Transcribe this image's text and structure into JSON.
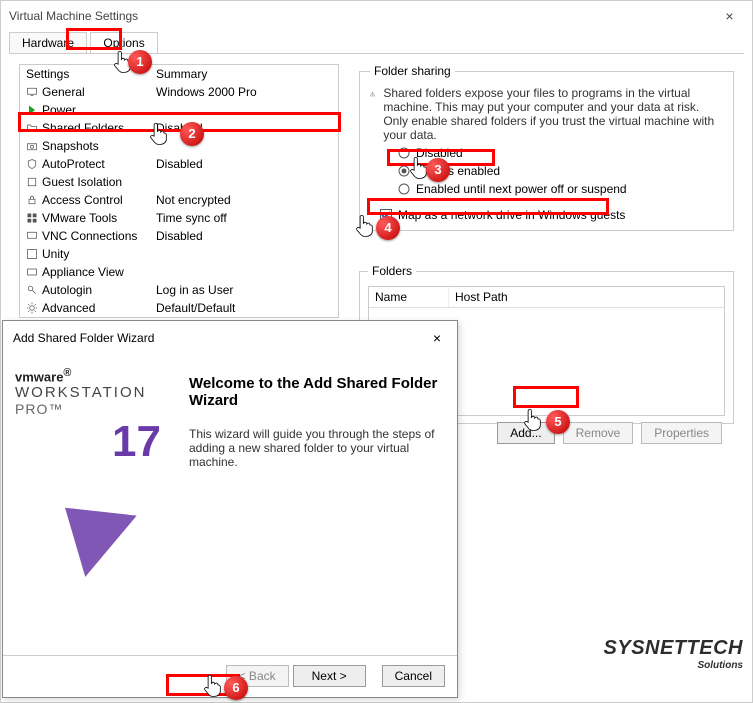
{
  "window": {
    "title": "Virtual Machine Settings"
  },
  "tabs": {
    "hardware": "Hardware",
    "options": "Options"
  },
  "list": {
    "hdr_settings": "Settings",
    "hdr_summary": "Summary",
    "rows": [
      {
        "name": "General",
        "summary": "Windows 2000 Pro"
      },
      {
        "name": "Power",
        "summary": ""
      },
      {
        "name": "Shared Folders",
        "summary": "Disabled"
      },
      {
        "name": "Snapshots",
        "summary": ""
      },
      {
        "name": "AutoProtect",
        "summary": "Disabled"
      },
      {
        "name": "Guest Isolation",
        "summary": ""
      },
      {
        "name": "Access Control",
        "summary": "Not encrypted"
      },
      {
        "name": "VMware Tools",
        "summary": "Time sync off"
      },
      {
        "name": "VNC Connections",
        "summary": "Disabled"
      },
      {
        "name": "Unity",
        "summary": ""
      },
      {
        "name": "Appliance View",
        "summary": ""
      },
      {
        "name": "Autologin",
        "summary": "Log in as User"
      },
      {
        "name": "Advanced",
        "summary": "Default/Default"
      }
    ]
  },
  "sharing": {
    "legend": "Folder sharing",
    "warning": "Shared folders expose your files to programs in the virtual machine. This may put your computer and your data at risk. Only enable shared folders if you trust the virtual machine with your data.",
    "opt_disabled": "Disabled",
    "opt_always": "Always enabled",
    "opt_until": "Enabled until next power off or suspend",
    "map_check": "Map as a network drive in Windows guests"
  },
  "folders": {
    "legend": "Folders",
    "col_name": "Name",
    "col_host": "Host Path",
    "btn_add": "Add...",
    "btn_remove": "Remove",
    "btn_props": "Properties"
  },
  "wizard": {
    "title": "Add Shared Folder Wizard",
    "brand1": "vmware",
    "brand2": "WORKSTATION",
    "brand3": "PRO™",
    "brand_ver": "17",
    "heading": "Welcome to the Add Shared Folder Wizard",
    "body": "This wizard will guide you through the steps of adding a new shared folder to your virtual machine.",
    "back": "< Back",
    "next": "Next >",
    "cancel": "Cancel"
  },
  "annotations": {
    "n1": "1",
    "n2": "2",
    "n3": "3",
    "n4": "4",
    "n5": "5",
    "n6": "6"
  },
  "watermark": {
    "main": "SYSNETTECH",
    "sub": "Solutions"
  }
}
